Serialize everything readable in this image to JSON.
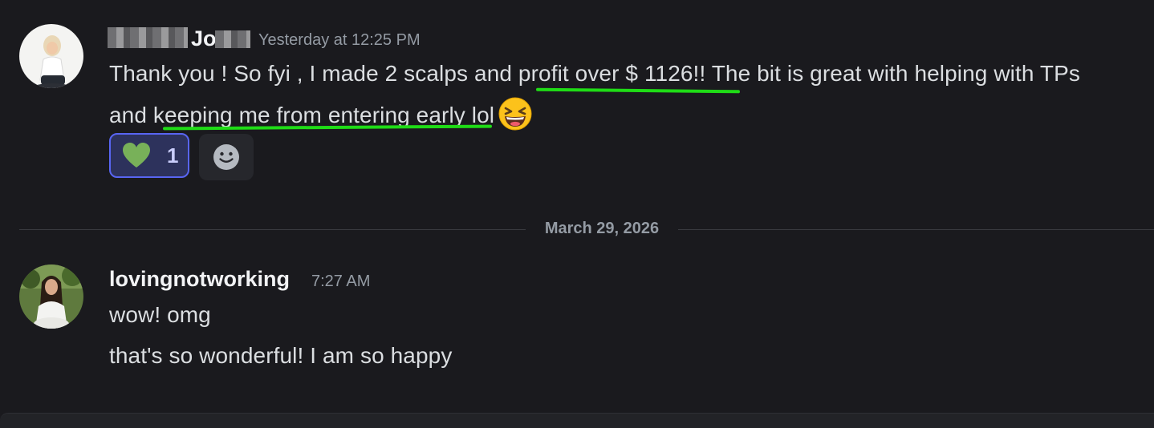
{
  "messages": [
    {
      "avatar_icon": "woman-avatar-icon",
      "username_visible": "Jo",
      "timestamp": "Yesterday at 12:25 PM",
      "lines": {
        "l1_a": "Thank you ! So fyi , I made 2 scalps and ",
        "l1_b": "profit over $ 1126!!",
        "l1_c": " The bit is great with helping with TPs",
        "l2_a": "and ",
        "l2_b": "keeping me from entering early",
        "l2_c": " lol"
      },
      "emoji": "laughing-face-emoji",
      "reactions": [
        {
          "icon": "green-heart-icon",
          "count": "1",
          "highlight_color": "#5865f2"
        }
      ],
      "add_reaction_icon": "smiley-add-reaction-icon",
      "underline_color": "#1fdc16"
    },
    {
      "avatar_icon": "woman-avatar-icon",
      "username": "lovingnotworking",
      "timestamp": "7:27 AM",
      "lines": [
        "wow! omg",
        "that's so wonderful! I am so happy"
      ]
    }
  ],
  "date_divider": "March 29, 2026",
  "colors": {
    "background": "#1a1a1e",
    "text": "#dbdee1",
    "muted": "#949ba4",
    "username": "#f2f3f5"
  }
}
